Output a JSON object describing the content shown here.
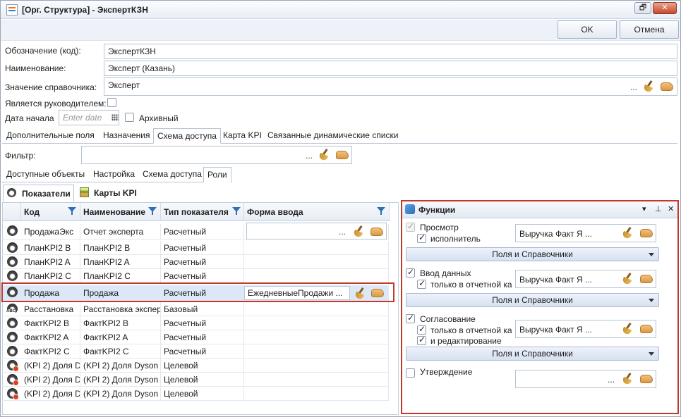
{
  "window": {
    "title": "[Орг. Структура] - ЭкспертКЗН",
    "restore_glyph": "🗗",
    "close_glyph": "✕"
  },
  "actions": {
    "ok": "OK",
    "cancel": "Отмена"
  },
  "form": {
    "code_label": "Обозначение (код):",
    "code_value": "ЭкспертКЗН",
    "name_label": "Наименование:",
    "name_value": "Эксперт (Казань)",
    "ref_label": "Значение справочника:",
    "ref_value": "Эксперт",
    "ellipsis": "...",
    "is_head_label": "Является руководителем:",
    "start_date_label": "Дата начала",
    "start_date_placeholder": "Enter date",
    "archived_label": "Архивный"
  },
  "tabs": [
    "Дополнительные поля",
    "Назначения",
    "Схема доступа",
    "Карта KPI",
    "Связанные динамические списки"
  ],
  "filter": {
    "label": "Фильтр:",
    "ellipsis": "..."
  },
  "subtabs": [
    "Доступные объекты",
    "Настройка",
    "Схема доступа",
    "Роли"
  ],
  "views": {
    "indicators": "Показатели",
    "kpi_cards": "Карты KPI"
  },
  "grid": {
    "columns": [
      "Код",
      "Наименование",
      "Тип показателя",
      "Форма ввода"
    ],
    "rows": [
      {
        "code": "ПродажаЭкс",
        "name": "Отчет эксперта",
        "type": "Расчетный",
        "form": "..."
      },
      {
        "code": "ПланKPI2 B",
        "name": "ПланKPI2 B",
        "type": "Расчетный",
        "form": ""
      },
      {
        "code": "ПланKPI2  A",
        "name": "ПланKPI2  A",
        "type": "Расчетный",
        "form": ""
      },
      {
        "code": "ПланKPI2 C",
        "name": "ПланKPI2 C",
        "type": "Расчетный",
        "form": ""
      },
      {
        "code": "Продажа",
        "name": "Продажа",
        "type": "Расчетный",
        "form": "ЕжедневныеПродажи ..."
      },
      {
        "code": "Расстановка",
        "name": "Расстановка экспер",
        "type": "Базовый",
        "form": ""
      },
      {
        "code": "ФактKPI2 B",
        "name": "ФактKPI2 B",
        "type": "Расчетный",
        "form": ""
      },
      {
        "code": "ФактKPI2 A",
        "name": "ФактKPI2 A",
        "type": "Расчетный",
        "form": ""
      },
      {
        "code": "ФактKPI2 C",
        "name": "ФактKPI2 C",
        "type": "Расчетный",
        "form": ""
      },
      {
        "code": "(KPI 2) Доля D",
        "name": "(KPI 2) Доля Dyson г",
        "type": "Целевой",
        "form": ""
      },
      {
        "code": "(KPI 2) Доля D",
        "name": "(KPI 2) Доля Dyson г",
        "type": "Целевой",
        "form": ""
      },
      {
        "code": "(KPI 2) Доля D",
        "name": "(KPI 2) Доля Dyson г",
        "type": "Целевой",
        "form": ""
      }
    ]
  },
  "functions": {
    "title": "Функции",
    "menu_glyph": "▾",
    "pin_glyph": "⊥",
    "close_glyph": "✕",
    "view": {
      "label": "Просмотр",
      "sub": "исполнитель",
      "value": "Выручка Факт Я ..."
    },
    "fields_bar": "Поля и Справочники",
    "input": {
      "label": "Ввод данных",
      "sub": "только в отчетной ка",
      "value": "Выручка Факт Я ..."
    },
    "approve": {
      "label": "Согласование",
      "sub1": "только в отчетной ка",
      "sub2": "и редактирование",
      "value": "Выручка Факт Я ..."
    },
    "confirm": {
      "label": "Утверждение",
      "value": "..."
    }
  },
  "colors": {
    "highlight_border": "#c0392b",
    "selected_row": "#dce8f8",
    "accent_blue": "#2e6fb8"
  }
}
